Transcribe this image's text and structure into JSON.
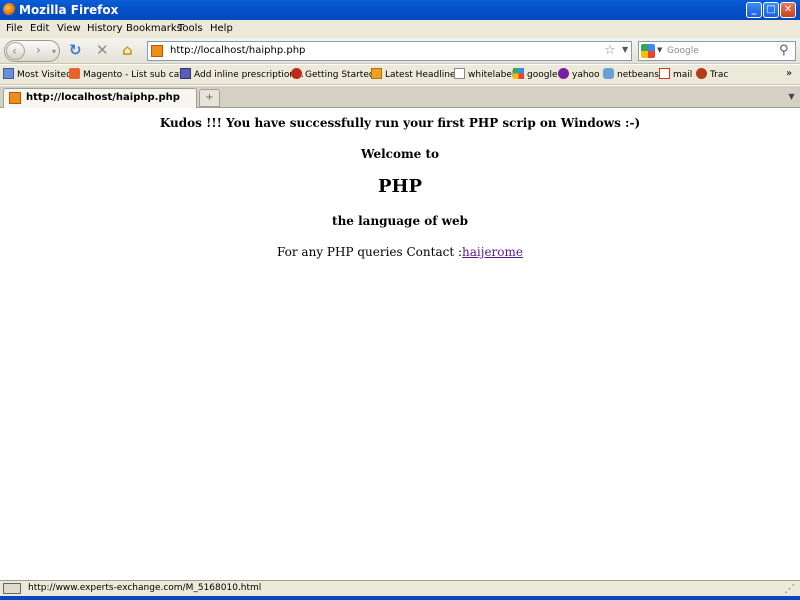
{
  "window": {
    "title": "Mozilla Firefox"
  },
  "menu": [
    "File",
    "Edit",
    "View",
    "History",
    "Bookmarks",
    "Tools",
    "Help"
  ],
  "toolbar": {
    "url": "http://localhost/haiphp.php",
    "search_placeholder": "Google"
  },
  "bookmarks": [
    {
      "label": "Most Visited",
      "icon": "most-visited-icon"
    },
    {
      "label": "Magento - List sub cat...",
      "icon": "magento-icon"
    },
    {
      "label": "Add inline prescription...",
      "icon": "page-icon"
    },
    {
      "label": "Getting Started",
      "icon": "firefox-icon"
    },
    {
      "label": "Latest Headlines",
      "icon": "rss-icon"
    },
    {
      "label": "whitelabel",
      "icon": "page-icon"
    },
    {
      "label": "google",
      "icon": "google-icon"
    },
    {
      "label": "yahoo",
      "icon": "yahoo-icon"
    },
    {
      "label": "netbeans",
      "icon": "netbeans-icon"
    },
    {
      "label": "mail",
      "icon": "gmail-icon"
    },
    {
      "label": "Trac",
      "icon": "trac-icon"
    }
  ],
  "tab": {
    "label": "http://localhost/haiphp.php"
  },
  "page": {
    "kudos": "Kudos !!! You have successfully run your first PHP scrip on Windows :-)",
    "welcome": "Welcome to",
    "php": "PHP",
    "language": "the language of web",
    "contact_prefix": "For any PHP queries Contact :",
    "contact_link": "haijerome"
  },
  "status": {
    "text": "http://www.experts-exchange.com/M_5168010.html"
  },
  "colors": {
    "titlebar": "#0451c8",
    "chrome": "#ece9d8",
    "link_visited": "#551a8b"
  }
}
